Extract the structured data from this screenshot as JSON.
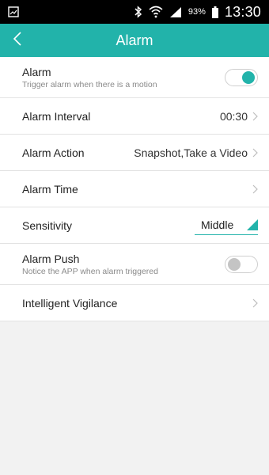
{
  "status_bar": {
    "battery_percent": "93%",
    "time": "13:30",
    "icons": [
      "gallery-icon",
      "bluetooth-icon",
      "wifi-icon",
      "signal-icon",
      "battery-icon"
    ]
  },
  "header": {
    "title": "Alarm",
    "back_icon": "chevron-left-icon"
  },
  "settings": {
    "alarm": {
      "label": "Alarm",
      "subtitle": "Trigger alarm when there is a motion",
      "enabled": true
    },
    "alarm_interval": {
      "label": "Alarm Interval",
      "value": "00:30"
    },
    "alarm_action": {
      "label": "Alarm Action",
      "value": "Snapshot,Take a Video"
    },
    "alarm_time": {
      "label": "Alarm Time",
      "value": ""
    },
    "sensitivity": {
      "label": "Sensitivity",
      "value": "Middle"
    },
    "alarm_push": {
      "label": "Alarm Push",
      "subtitle": "Notice the APP when alarm triggered",
      "enabled": false
    },
    "intelligent_vigilance": {
      "label": "Intelligent Vigilance"
    }
  },
  "colors": {
    "accent": "#22b3aa",
    "background": "#f2f2f2",
    "status_bar": "#000000"
  }
}
